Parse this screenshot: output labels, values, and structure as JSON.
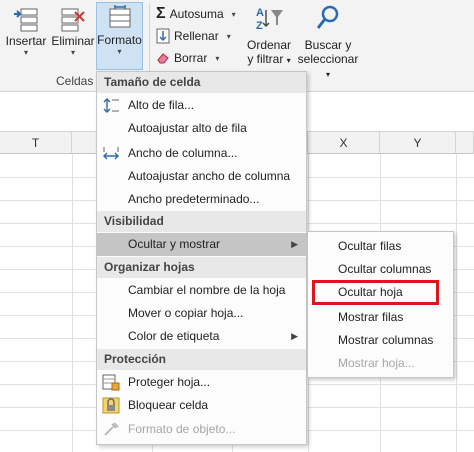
{
  "ribbon": {
    "insert": {
      "label": "Insertar",
      "icon": "insert-cells-icon"
    },
    "delete": {
      "label": "Eliminar",
      "icon": "delete-cells-icon"
    },
    "format": {
      "label": "Formato",
      "icon": "format-cells-icon"
    },
    "group_label": "Celdas",
    "autosum": {
      "label": "Autosuma",
      "icon": "sigma-icon"
    },
    "fill": {
      "label": "Rellenar",
      "icon": "fill-down-icon"
    },
    "clear": {
      "label": "Borrar",
      "icon": "eraser-icon"
    },
    "sort": {
      "label1": "Ordenar",
      "label2": "y filtrar",
      "icon": "sort-filter-icon"
    },
    "find": {
      "label1": "Buscar y",
      "label2": "seleccionar",
      "icon": "magnifier-icon"
    }
  },
  "sheet": {
    "columns": [
      "T",
      "X",
      "Y"
    ]
  },
  "menu": {
    "cell_size_header": "Tamaño de celda",
    "row_height": "Alto de fila...",
    "autofit_row": "Autoajustar alto de fila",
    "column_width": "Ancho de columna...",
    "autofit_column": "Autoajustar ancho de columna",
    "default_width": "Ancho predeterminado...",
    "visibility_header": "Visibilidad",
    "hide_show": "Ocultar y mostrar",
    "organize_header": "Organizar hojas",
    "rename_sheet": "Cambiar el nombre de la hoja",
    "move_copy": "Mover o copiar hoja...",
    "tab_color": "Color de etiqueta",
    "protection_header": "Protección",
    "protect_sheet": "Proteger hoja...",
    "lock_cell": "Bloquear celda",
    "format_object": "Formato de objeto..."
  },
  "submenu": {
    "hide_rows": "Ocultar filas",
    "hide_columns": "Ocultar columnas",
    "hide_sheet": "Ocultar hoja",
    "show_rows": "Mostrar filas",
    "show_columns": "Mostrar columnas",
    "show_sheet": "Mostrar hoja..."
  },
  "colors": {
    "highlight": "#e0141e",
    "hover": "#c5c5c5",
    "accent_blue": "#2b6cb0"
  }
}
